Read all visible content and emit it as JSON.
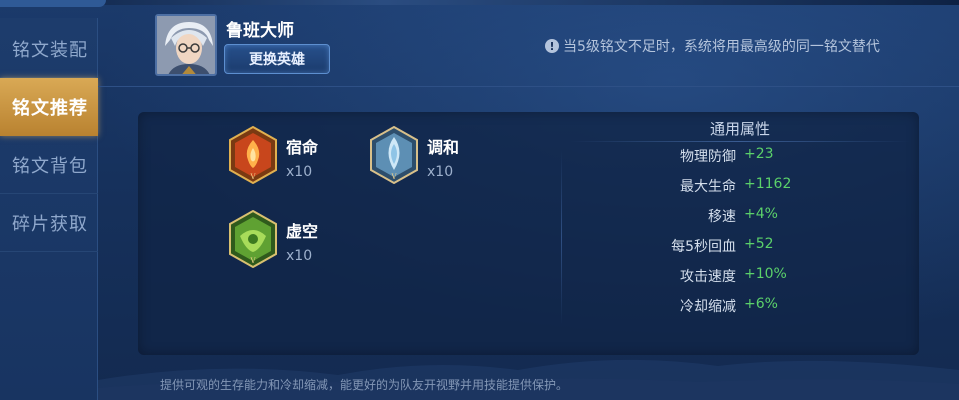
{
  "sidebar": {
    "items": [
      {
        "label": "铭文装配"
      },
      {
        "label": "铭文推荐"
      },
      {
        "label": "铭文背包"
      },
      {
        "label": "碎片获取"
      }
    ]
  },
  "header": {
    "hero_name": "鲁班大师",
    "change_hero_button": "更换英雄",
    "notice": "当5级铭文不足时，系统将用最高级的同一铭文替代"
  },
  "runes": [
    {
      "name": "宿命",
      "count": "x10",
      "icon": "fate-rune-icon",
      "color": "#d9592a"
    },
    {
      "name": "调和",
      "count": "x10",
      "icon": "harmony-rune-icon",
      "color": "#8fc4e6"
    },
    {
      "name": "虚空",
      "count": "x10",
      "icon": "void-rune-icon",
      "color": "#6ab33a"
    }
  ],
  "attributes": {
    "title": "通用属性",
    "rows": [
      {
        "label": "物理防御",
        "value": "+23"
      },
      {
        "label": "最大生命",
        "value": "+1162"
      },
      {
        "label": "移速",
        "value": "+4%"
      },
      {
        "label": "每5秒回血",
        "value": "+52"
      },
      {
        "label": "攻击速度",
        "value": "+10%"
      },
      {
        "label": "冷却缩减",
        "value": "+6%"
      }
    ]
  },
  "footer": {
    "description": "提供可观的生存能力和冷却缩减，能更好的为队友开视野并用技能提供保护。"
  },
  "colors": {
    "accent_gold": "#d9a955",
    "positive_green": "#5bd16a",
    "background_blue": "#16305a"
  }
}
